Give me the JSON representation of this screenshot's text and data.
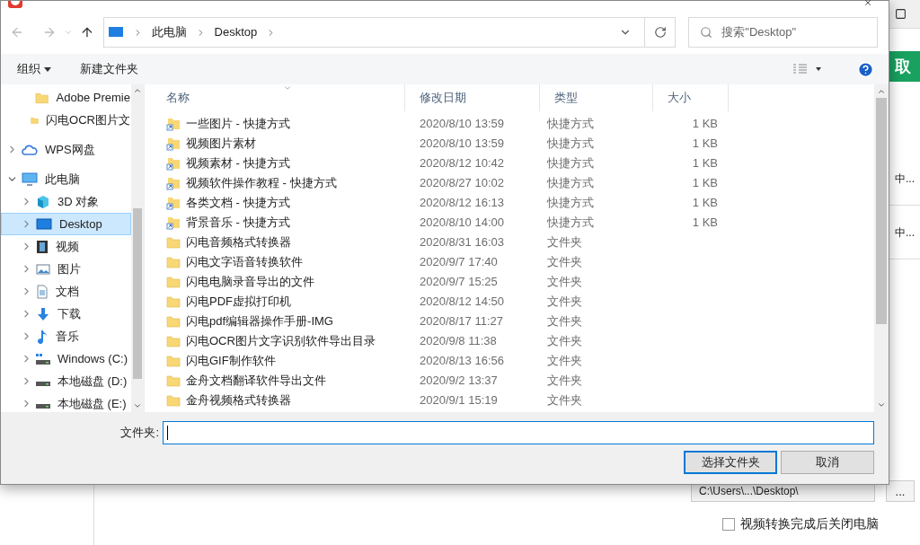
{
  "dialog": {
    "breadcrumb": [
      "此电脑",
      "Desktop"
    ],
    "search": {
      "placeholder": "搜索\"Desktop\""
    },
    "toolbar": {
      "organize": "组织",
      "new_folder": "新建文件夹"
    },
    "sidebar": {
      "items": [
        {
          "label": "Adobe Premie",
          "kind": "folder"
        },
        {
          "label": "闪电OCR图片文",
          "kind": "folder"
        },
        {
          "label": "WPS网盘",
          "kind": "cloud",
          "expanded": false
        },
        {
          "label": "此电脑",
          "kind": "pc",
          "expanded": true,
          "children": [
            {
              "label": "3D 对象",
              "kind": "cube",
              "expanded": false,
              "selected": false
            },
            {
              "label": "Desktop",
              "kind": "desktop",
              "expanded": false,
              "selected": true
            },
            {
              "label": "视频",
              "kind": "video",
              "expanded": false,
              "selected": false
            },
            {
              "label": "图片",
              "kind": "picture",
              "expanded": false,
              "selected": false
            },
            {
              "label": "文档",
              "kind": "document",
              "expanded": false,
              "selected": false
            },
            {
              "label": "下载",
              "kind": "download",
              "expanded": false,
              "selected": false
            },
            {
              "label": "音乐",
              "kind": "music",
              "expanded": false,
              "selected": false
            },
            {
              "label": "Windows (C:)",
              "kind": "system-drive",
              "expanded": false,
              "selected": false
            },
            {
              "label": "本地磁盘 (D:)",
              "kind": "drive",
              "expanded": false,
              "selected": false
            },
            {
              "label": "本地磁盘 (E:)",
              "kind": "drive",
              "expanded": false,
              "selected": false
            }
          ]
        }
      ]
    },
    "table": {
      "columns": [
        "名称",
        "修改日期",
        "类型",
        "大小"
      ],
      "rows": [
        {
          "kind": "shortcut",
          "name": "一些图片 - 快捷方式",
          "modified": "2020/8/10 13:59",
          "type": "快捷方式",
          "size": "1 KB"
        },
        {
          "kind": "shortcut",
          "name": "视频图片素材",
          "modified": "2020/8/10 13:59",
          "type": "快捷方式",
          "size": "1 KB"
        },
        {
          "kind": "shortcut",
          "name": "视频素材 - 快捷方式",
          "modified": "2020/8/12 10:42",
          "type": "快捷方式",
          "size": "1 KB"
        },
        {
          "kind": "shortcut",
          "name": "视频软件操作教程 - 快捷方式",
          "modified": "2020/8/27 10:02",
          "type": "快捷方式",
          "size": "1 KB"
        },
        {
          "kind": "shortcut",
          "name": "各类文档 - 快捷方式",
          "modified": "2020/8/12 16:13",
          "type": "快捷方式",
          "size": "1 KB"
        },
        {
          "kind": "shortcut",
          "name": "背景音乐 - 快捷方式",
          "modified": "2020/8/10 14:00",
          "type": "快捷方式",
          "size": "1 KB"
        },
        {
          "kind": "folder",
          "name": "闪电音频格式转换器",
          "modified": "2020/8/31 16:03",
          "type": "文件夹"
        },
        {
          "kind": "folder",
          "name": "闪电文字语音转换软件",
          "modified": "2020/9/7 17:40",
          "type": "文件夹"
        },
        {
          "kind": "folder",
          "name": "闪电电脑录音导出的文件",
          "modified": "2020/9/7 15:25",
          "type": "文件夹"
        },
        {
          "kind": "folder",
          "name": "闪电PDF虚拟打印机",
          "modified": "2020/8/12 14:50",
          "type": "文件夹"
        },
        {
          "kind": "folder",
          "name": "闪电pdf编辑器操作手册-IMG",
          "modified": "2020/8/17 11:27",
          "type": "文件夹"
        },
        {
          "kind": "folder",
          "name": "闪电OCR图片文字识别软件导出目录",
          "modified": "2020/9/8 11:38",
          "type": "文件夹"
        },
        {
          "kind": "folder",
          "name": "闪电GIF制作软件",
          "modified": "2020/8/13 16:56",
          "type": "文件夹"
        },
        {
          "kind": "folder",
          "name": "金舟文档翻译软件导出文件",
          "modified": "2020/9/2 13:37",
          "type": "文件夹"
        },
        {
          "kind": "folder",
          "name": "金舟视频格式转换器",
          "modified": "2020/9/1 15:19",
          "type": "文件夹"
        }
      ]
    },
    "folder_field": {
      "label": "文件夹:"
    },
    "buttons": [
      {
        "label": "选择文件夹",
        "default": true
      },
      {
        "label": "取消",
        "default": false
      }
    ]
  },
  "background": {
    "extract_button": "取",
    "statuses": [
      "中...",
      "中..."
    ],
    "path": "C:\\Users\\...\\Desktop\\",
    "more_button": "...",
    "shutdown_option": {
      "label": "视频转换完成后关闭电脑",
      "checked": false
    }
  }
}
